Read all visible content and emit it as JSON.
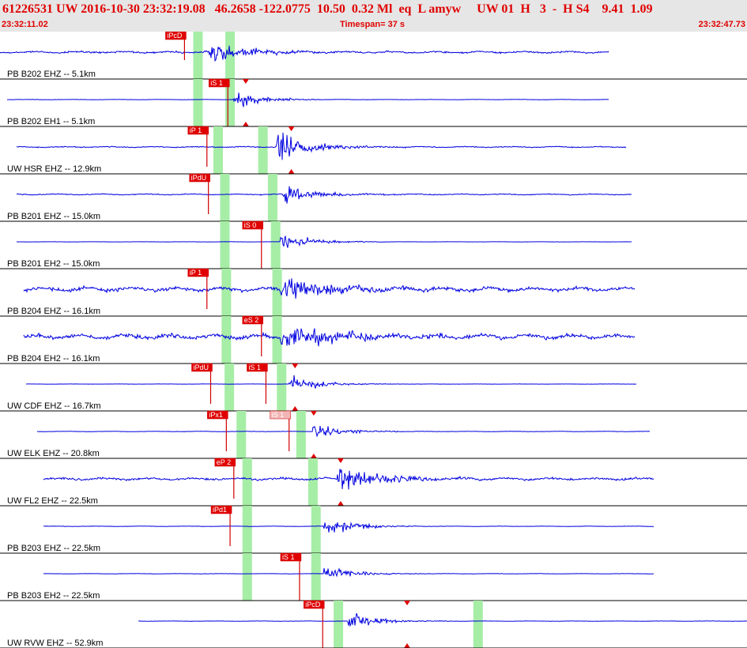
{
  "header": {
    "title": "61226531 UW 2016-10-30 23:32:19.08   46.2658 -122.0775  10.50  0.32 Ml  eq  L amyw     UW 01  H   3  -  H S4    9.41  1.09",
    "start_time": "23:32:11.02",
    "timespan": "Timespan=  37 s",
    "end_time": "23:32:47.73"
  },
  "colors": {
    "trace": "#0000e0",
    "pick_box": "#e00000",
    "pick_box_light": "#f2b5b5",
    "pick_line": "#d00000",
    "window": "#a6eda6",
    "divider": "#000000",
    "marker": "#e00000"
  },
  "traces": [
    {
      "label": "PB B202 EHZ -- 5.1km",
      "start": 0.0,
      "end": 0.815,
      "noise": 0.18,
      "event": 0.28,
      "amp": 0.55,
      "windows": [
        0.265,
        0.308
      ],
      "picks": [
        {
          "label": "iPcD",
          "t": 0.247,
          "dx": -1,
          "light": false,
          "line_end": 0.6
        }
      ],
      "markers": []
    },
    {
      "label": "PB B202 EH1 -- 5.1km",
      "start": 0.01,
      "end": 0.815,
      "noise": 0.03,
      "event": 0.312,
      "amp": 0.5,
      "windows": [
        0.265,
        0.308
      ],
      "picks": [
        {
          "label": "iS 1",
          "t": 0.305,
          "dx": -1,
          "light": false,
          "line_end": 1.0
        }
      ],
      "markers": [
        0.329
      ]
    },
    {
      "label": "UW HSR EHZ -- 12.9km",
      "start": 0.022,
      "end": 0.838,
      "noise": 0.1,
      "event": 0.37,
      "amp": 0.85,
      "windows": [
        0.292,
        0.352
      ],
      "picks": [
        {
          "label": "iP 1",
          "t": 0.277,
          "dx": -1,
          "light": false,
          "line_end": 0.85
        }
      ],
      "markers": [
        0.39
      ]
    },
    {
      "label": "PB B201 EHZ -- 15.0km",
      "start": 0.022,
      "end": 0.845,
      "noise": 0.1,
      "event": 0.378,
      "amp": 0.45,
      "windows": [
        0.301,
        0.365
      ],
      "picks": [
        {
          "label": "iPdU",
          "t": 0.279,
          "dx": -1,
          "light": false,
          "line_end": 0.85
        }
      ],
      "markers": []
    },
    {
      "label": "PB B201 EH2 -- 15.0km",
      "start": 0.022,
      "end": 0.845,
      "noise": 0.02,
      "event": 0.375,
      "amp": 0.6,
      "windows": [
        0.301,
        0.369
      ],
      "picks": [
        {
          "label": "iS 0",
          "t": 0.35,
          "dx": -1,
          "light": false,
          "line_end": 1.0
        }
      ],
      "markers": []
    },
    {
      "label": "PB B204 EHZ -- 16.1km",
      "start": 0.032,
      "end": 0.85,
      "noise": 0.38,
      "event": 0.375,
      "amp": 0.65,
      "windows": [
        0.303,
        0.371
      ],
      "picks": [
        {
          "label": "iP 1",
          "t": 0.277,
          "dx": -1,
          "light": false,
          "line_end": 0.85
        }
      ],
      "markers": []
    },
    {
      "label": "PB B204 EH2 -- 16.1km",
      "start": 0.032,
      "end": 0.85,
      "noise": 0.42,
      "event": 0.375,
      "amp": 0.6,
      "windows": [
        0.303,
        0.371
      ],
      "picks": [
        {
          "label": "eS 2",
          "t": 0.35,
          "dx": -1,
          "light": false,
          "line_end": 0.85
        }
      ],
      "markers": []
    },
    {
      "label": "UW CDF EHZ -- 16.7km",
      "start": 0.035,
      "end": 0.852,
      "noise": 0.02,
      "event": 0.387,
      "amp": 0.55,
      "windows": [
        0.307,
        0.377
      ],
      "picks": [
        {
          "label": "iPdU",
          "t": 0.282,
          "dx": -1,
          "light": false,
          "line_end": 0.85
        },
        {
          "label": "iS 1",
          "t": 0.356,
          "dx": -1,
          "light": false,
          "line_end": 0.85
        }
      ],
      "markers": [
        0.395
      ]
    },
    {
      "label": "UW ELK EHZ -- 20.8km",
      "start": 0.05,
      "end": 0.87,
      "noise": 0.04,
      "event": 0.418,
      "amp": 0.5,
      "windows": [
        0.323,
        0.403
      ],
      "picks": [
        {
          "label": "iPx1",
          "t": 0.303,
          "dx": -1,
          "light": false,
          "line_end": 0.85
        },
        {
          "label": "iS 1",
          "t": 0.387,
          "dx": -1,
          "light": true,
          "line_end": 0.85
        }
      ],
      "markers": [
        0.42
      ]
    },
    {
      "label": "UW FL2 EHZ -- 22.5km",
      "start": 0.058,
      "end": 0.875,
      "noise": 0.22,
      "event": 0.45,
      "amp": 0.7,
      "windows": [
        0.331,
        0.419
      ],
      "picks": [
        {
          "label": "eP 2",
          "t": 0.313,
          "dx": -1,
          "light": false,
          "line_end": 0.85
        }
      ],
      "markers": [
        0.456
      ]
    },
    {
      "label": "PB B203 EHZ -- 22.5km",
      "start": 0.058,
      "end": 0.875,
      "noise": 0.04,
      "event": 0.433,
      "amp": 0.55,
      "windows": [
        0.331,
        0.423
      ],
      "picks": [
        {
          "label": "iPd1",
          "t": 0.308,
          "dx": -1,
          "light": false,
          "line_end": 0.85
        }
      ],
      "markers": []
    },
    {
      "label": "PB B203 EH2 -- 22.5km",
      "start": 0.058,
      "end": 0.875,
      "noise": 0.03,
      "event": 0.433,
      "amp": 0.5,
      "windows": [
        0.331,
        0.423
      ],
      "picks": [
        {
          "label": "iS 1",
          "t": 0.401,
          "dx": -1,
          "light": false,
          "line_end": 1.0
        }
      ],
      "markers": []
    },
    {
      "label": "UW RVW EHZ -- 52.9km",
      "start": 0.185,
      "end": 1.0,
      "noise": 0.03,
      "event": 0.465,
      "amp": 0.5,
      "windows": [
        0.453,
        0.64
      ],
      "picks": [
        {
          "label": "iPcD",
          "t": 0.432,
          "dx": -1,
          "light": false,
          "line_end": 1.0
        }
      ],
      "markers": [
        0.545
      ]
    }
  ]
}
